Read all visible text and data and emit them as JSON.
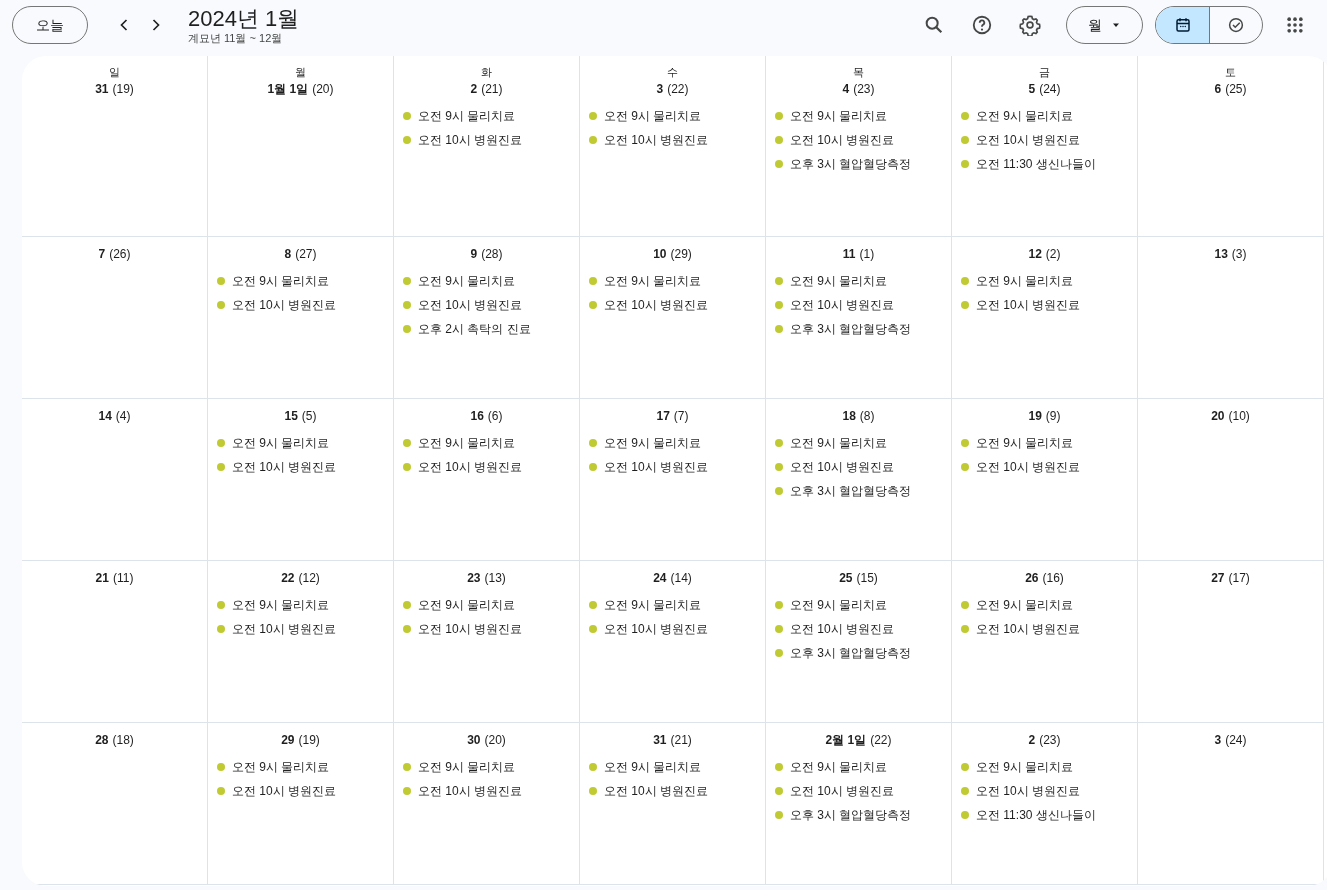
{
  "toolbar": {
    "today_button": "오늘",
    "title": "2024년 1월",
    "subtitle": "계묘년 11월 ~ 12월",
    "view_select": "월",
    "view_toggle": [
      {
        "kind": "calendar",
        "selected": true
      },
      {
        "kind": "tasks",
        "selected": false
      }
    ]
  },
  "weekdays": [
    "일",
    "월",
    "화",
    "수",
    "목",
    "금",
    "토"
  ],
  "weeks": [
    [
      {
        "day": "31",
        "lunar": "(19)"
      },
      {
        "day": "1월 1일",
        "lunar": "(20)"
      },
      {
        "day": "2",
        "lunar": "(21)",
        "events": [
          "오전 9시 물리치료",
          "오전 10시 병원진료"
        ]
      },
      {
        "day": "3",
        "lunar": "(22)",
        "events": [
          "오전 9시 물리치료",
          "오전 10시 병원진료"
        ]
      },
      {
        "day": "4",
        "lunar": "(23)",
        "events": [
          "오전 9시 물리치료",
          "오전 10시 병원진료",
          "오후 3시 혈압혈당측정"
        ]
      },
      {
        "day": "5",
        "lunar": "(24)",
        "events": [
          "오전 9시 물리치료",
          "오전 10시 병원진료",
          "오전 11:30 생신나들이"
        ]
      },
      {
        "day": "6",
        "lunar": "(25)"
      }
    ],
    [
      {
        "day": "7",
        "lunar": "(26)"
      },
      {
        "day": "8",
        "lunar": "(27)",
        "events": [
          "오전 9시 물리치료",
          "오전 10시 병원진료"
        ]
      },
      {
        "day": "9",
        "lunar": "(28)",
        "events": [
          "오전 9시 물리치료",
          "오전 10시 병원진료",
          "오후 2시 촉탁의 진료"
        ]
      },
      {
        "day": "10",
        "lunar": "(29)",
        "events": [
          "오전 9시 물리치료",
          "오전 10시 병원진료"
        ]
      },
      {
        "day": "11",
        "lunar": "(1)",
        "events": [
          "오전 9시 물리치료",
          "오전 10시 병원진료",
          "오후 3시 혈압혈당측정"
        ]
      },
      {
        "day": "12",
        "lunar": "(2)",
        "events": [
          "오전 9시 물리치료",
          "오전 10시 병원진료"
        ]
      },
      {
        "day": "13",
        "lunar": "(3)"
      }
    ],
    [
      {
        "day": "14",
        "lunar": "(4)"
      },
      {
        "day": "15",
        "lunar": "(5)",
        "events": [
          "오전 9시 물리치료",
          "오전 10시 병원진료"
        ]
      },
      {
        "day": "16",
        "lunar": "(6)",
        "events": [
          "오전 9시 물리치료",
          "오전 10시 병원진료"
        ]
      },
      {
        "day": "17",
        "lunar": "(7)",
        "events": [
          "오전 9시 물리치료",
          "오전 10시 병원진료"
        ]
      },
      {
        "day": "18",
        "lunar": "(8)",
        "events": [
          "오전 9시 물리치료",
          "오전 10시 병원진료",
          "오후 3시 혈압혈당측정"
        ]
      },
      {
        "day": "19",
        "lunar": "(9)",
        "events": [
          "오전 9시 물리치료",
          "오전 10시 병원진료"
        ]
      },
      {
        "day": "20",
        "lunar": "(10)"
      }
    ],
    [
      {
        "day": "21",
        "lunar": "(11)"
      },
      {
        "day": "22",
        "lunar": "(12)",
        "events": [
          "오전 9시 물리치료",
          "오전 10시 병원진료"
        ]
      },
      {
        "day": "23",
        "lunar": "(13)",
        "events": [
          "오전 9시 물리치료",
          "오전 10시 병원진료"
        ]
      },
      {
        "day": "24",
        "lunar": "(14)",
        "events": [
          "오전 9시 물리치료",
          "오전 10시 병원진료"
        ]
      },
      {
        "day": "25",
        "lunar": "(15)",
        "events": [
          "오전 9시 물리치료",
          "오전 10시 병원진료",
          "오후 3시 혈압혈당측정"
        ]
      },
      {
        "day": "26",
        "lunar": "(16)",
        "events": [
          "오전 9시 물리치료",
          "오전 10시 병원진료"
        ]
      },
      {
        "day": "27",
        "lunar": "(17)"
      }
    ],
    [
      {
        "day": "28",
        "lunar": "(18)"
      },
      {
        "day": "29",
        "lunar": "(19)",
        "events": [
          "오전 9시 물리치료",
          "오전 10시 병원진료"
        ]
      },
      {
        "day": "30",
        "lunar": "(20)",
        "events": [
          "오전 9시 물리치료",
          "오전 10시 병원진료"
        ]
      },
      {
        "day": "31",
        "lunar": "(21)",
        "events": [
          "오전 9시 물리치료",
          "오전 10시 병원진료"
        ]
      },
      {
        "day": "2월 1일",
        "lunar": "(22)",
        "events": [
          "오전 9시 물리치료",
          "오전 10시 병원진료",
          "오후 3시 혈압혈당측정"
        ]
      },
      {
        "day": "2",
        "lunar": "(23)",
        "events": [
          "오전 9시 물리치료",
          "오전 10시 병원진료",
          "오전 11:30 생신나들이"
        ]
      },
      {
        "day": "3",
        "lunar": "(24)"
      }
    ]
  ]
}
